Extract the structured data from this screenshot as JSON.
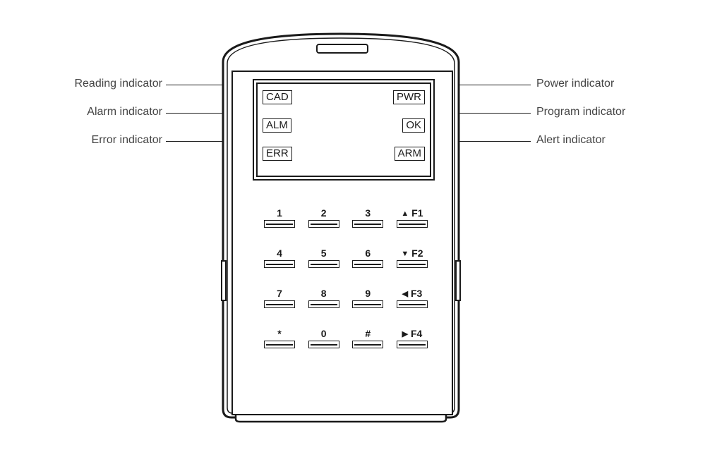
{
  "indicators": {
    "left": [
      {
        "code": "CAD",
        "desc": "Reading indicator"
      },
      {
        "code": "ALM",
        "desc": "Alarm indicator"
      },
      {
        "code": "ERR",
        "desc": "Error indicator"
      }
    ],
    "right": [
      {
        "code": "PWR",
        "desc": "Power indicator"
      },
      {
        "code": "OK",
        "desc": "Program indicator"
      },
      {
        "code": "ARM",
        "desc": "Alert indicator"
      }
    ]
  },
  "keypad": {
    "rows": [
      [
        {
          "label": "1"
        },
        {
          "label": "2"
        },
        {
          "label": "3"
        },
        {
          "arrow": "▲",
          "label": "F1"
        }
      ],
      [
        {
          "label": "4"
        },
        {
          "label": "5"
        },
        {
          "label": "6"
        },
        {
          "arrow": "▼",
          "label": "F2"
        }
      ],
      [
        {
          "label": "7"
        },
        {
          "label": "8"
        },
        {
          "label": "9"
        },
        {
          "arrow": "◀",
          "label": "F3"
        }
      ],
      [
        {
          "label": "*"
        },
        {
          "label": "0"
        },
        {
          "label": "#"
        },
        {
          "arrow": "▶",
          "label": "F4"
        }
      ]
    ]
  }
}
